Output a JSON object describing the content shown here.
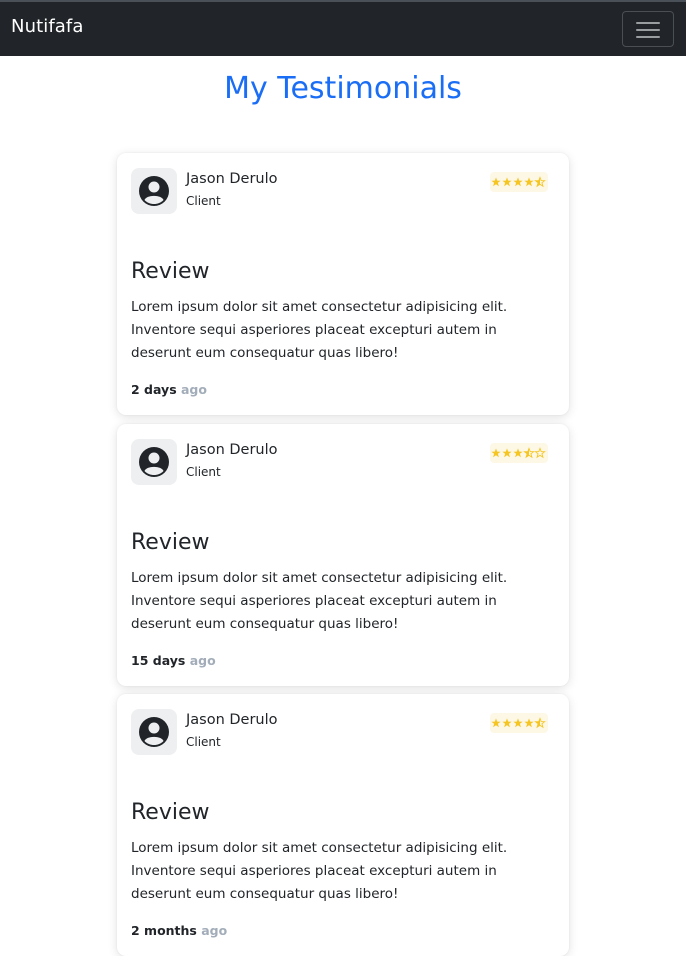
{
  "navbar": {
    "brand": "Nutifafa",
    "toggler_icon": "hamburger-menu-icon"
  },
  "page": {
    "title": "My Testimonials"
  },
  "colors": {
    "navbar_bg": "#212529",
    "title": "#1a6ef5",
    "star": "#f5c523",
    "ago_text": "#a2adb9"
  },
  "testimonials": [
    {
      "name": "Jason Derulo",
      "role": "Client",
      "rating": 4.5,
      "rating_max": 5,
      "review_title": "Review",
      "review_text": "Lorem ipsum dolor sit amet consectetur adipisicing elit. Inventore sequi asperiores placeat excepturi autem in deserunt eum consequatur quas libero!",
      "time_value": "2 days",
      "time_suffix": "ago"
    },
    {
      "name": "Jason Derulo",
      "role": "Client",
      "rating": 3.5,
      "rating_max": 5,
      "review_title": "Review",
      "review_text": "Lorem ipsum dolor sit amet consectetur adipisicing elit. Inventore sequi asperiores placeat excepturi autem in deserunt eum consequatur quas libero!",
      "time_value": "15 days",
      "time_suffix": "ago"
    },
    {
      "name": "Jason Derulo",
      "role": "Client",
      "rating": 4.5,
      "rating_max": 5,
      "review_title": "Review",
      "review_text": "Lorem ipsum dolor sit amet consectetur adipisicing elit. Inventore sequi asperiores placeat excepturi autem in deserunt eum consequatur quas libero!",
      "time_value": "2 months",
      "time_suffix": "ago"
    }
  ]
}
